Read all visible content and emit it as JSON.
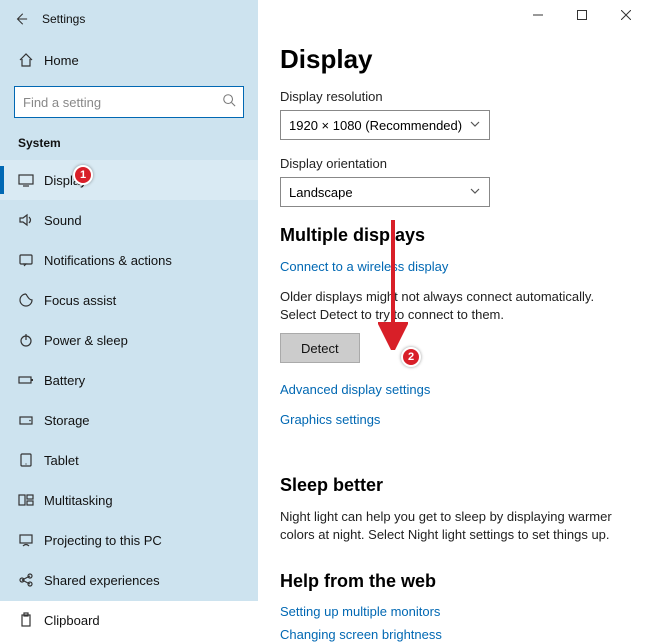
{
  "app_title": "Settings",
  "home_label": "Home",
  "search_placeholder": "Find a setting",
  "category": "System",
  "sidebar": {
    "items": [
      {
        "label": "Display"
      },
      {
        "label": "Sound"
      },
      {
        "label": "Notifications & actions"
      },
      {
        "label": "Focus assist"
      },
      {
        "label": "Power & sleep"
      },
      {
        "label": "Battery"
      },
      {
        "label": "Storage"
      },
      {
        "label": "Tablet"
      },
      {
        "label": "Multitasking"
      },
      {
        "label": "Projecting to this PC"
      },
      {
        "label": "Shared experiences"
      },
      {
        "label": "Clipboard"
      }
    ]
  },
  "page": {
    "title": "Display",
    "resolution_label": "Display resolution",
    "resolution_value": "1920 × 1080 (Recommended)",
    "orientation_label": "Display orientation",
    "orientation_value": "Landscape",
    "multi_heading": "Multiple displays",
    "connect_link": "Connect to a wireless display",
    "older_text": "Older displays might not always connect automatically. Select Detect to try to connect to them.",
    "detect_btn": "Detect",
    "adv_link": "Advanced display settings",
    "gfx_link": "Graphics settings",
    "sleep_heading": "Sleep better",
    "sleep_text": "Night light can help you get to sleep by displaying warmer colors at night. Select Night light settings to set things up.",
    "help_heading": "Help from the web",
    "help_link1": "Setting up multiple monitors",
    "help_link2": "Changing screen brightness"
  },
  "callouts": {
    "one": "1",
    "two": "2"
  }
}
